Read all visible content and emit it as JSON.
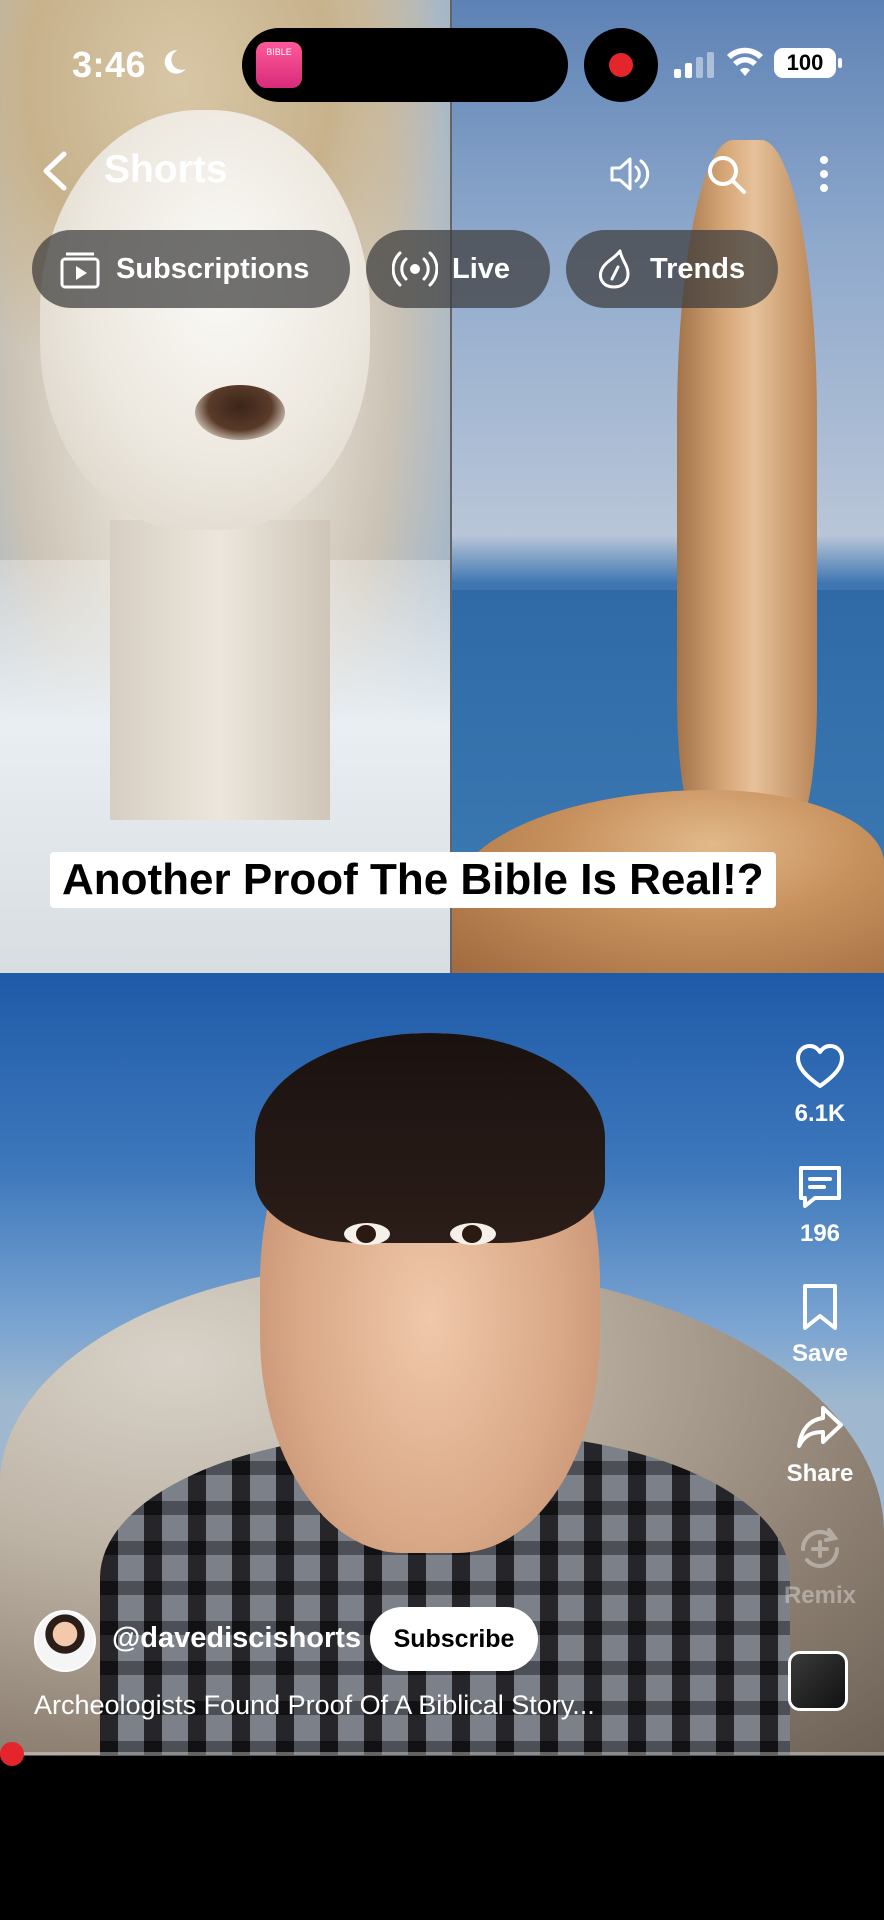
{
  "status_bar": {
    "time": "3:46",
    "battery": "100",
    "live_app_badge": "BIBLE"
  },
  "header": {
    "title": "Shorts"
  },
  "chips": [
    {
      "label": "Subscriptions",
      "icon": "subscriptions-icon"
    },
    {
      "label": "Live",
      "icon": "live-icon"
    },
    {
      "label": "Trends",
      "icon": "trends-icon"
    }
  ],
  "video": {
    "overlay_title": "Another Proof The Bible Is Real!?",
    "channel": "@davediscishorts",
    "subscribe_label": "Subscribe",
    "description": "Archeologists Found Proof Of A Biblical Story...",
    "progress_fraction": 0.01
  },
  "actions": {
    "like_count": "6.1K",
    "comment_count": "196",
    "save_label": "Save",
    "share_label": "Share",
    "remix_label": "Remix"
  },
  "colors": {
    "accent_red": "#e3262b",
    "chip_bg": "#3c3c3c"
  }
}
